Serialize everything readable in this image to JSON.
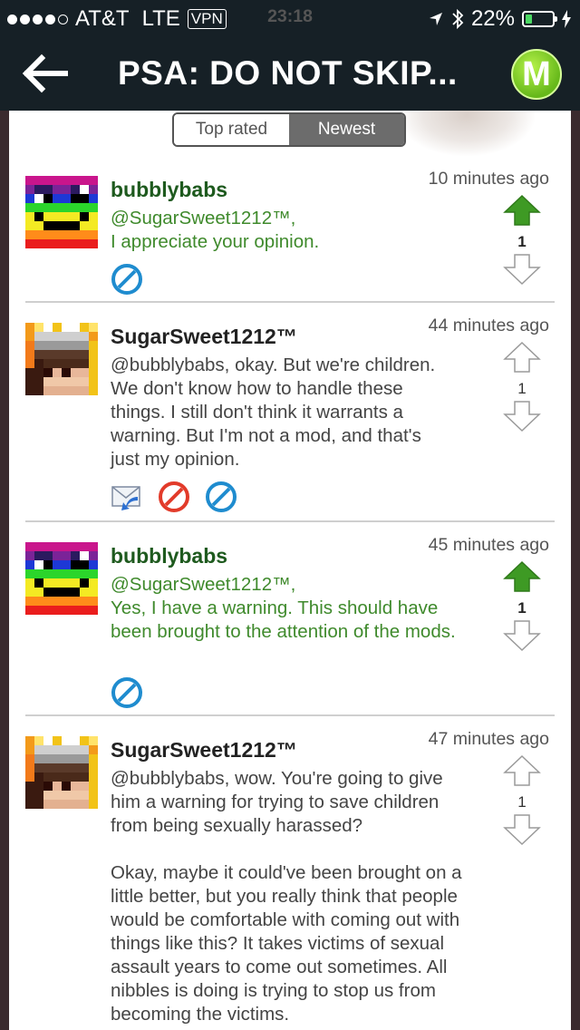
{
  "status_bar": {
    "carrier": "AT&T",
    "network": "LTE",
    "vpn": "VPN",
    "time": "23:18",
    "battery": "22%",
    "battery_level": 0.22
  },
  "nav": {
    "title": "PSA: DO NOT SKIP...",
    "logo": "M"
  },
  "tabs": [
    {
      "label": "Top rated",
      "active": false
    },
    {
      "label": "Newest",
      "active": true
    }
  ],
  "comments": [
    {
      "username": "bubblybabs",
      "time": "10 minutes ago",
      "paragraphs": [
        "@SugarSweet1212™,\nI appreciate your opinion."
      ],
      "votes": "1"
    },
    {
      "username": "SugarSweet1212™",
      "time": "44 minutes ago",
      "paragraphs": [
        "@bubblybabs, okay. But we're children. We don't know how to handle these things. I still don't think it warrants a warning. But I'm not a mod, and that's just my opinion."
      ],
      "votes": "1"
    },
    {
      "username": "bubblybabs",
      "time": "45 minutes ago",
      "paragraphs": [
        "@SugarSweet1212™,\nYes, I have a warning. This should have been brought to the attention of the mods."
      ],
      "votes": "1"
    },
    {
      "username": "SugarSweet1212™",
      "time": "47 minutes ago",
      "paragraphs": [
        "@bubblybabs, wow. You're going to give him a warning for trying to save children from being sexually harassed?",
        "Okay, maybe it could've been brought on a little better, but you really think that people would be comfortable with coming out with things like this? It takes victims of sexual assault years to come out sometimes. All nibbles is doing is trying to stop us from becoming the victims."
      ],
      "votes": "1"
    }
  ]
}
